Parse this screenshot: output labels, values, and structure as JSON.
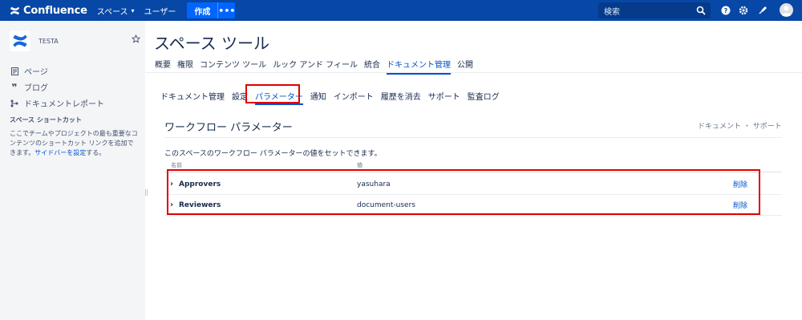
{
  "topbar": {
    "app_name": "Confluence",
    "spaces_label": "スペース",
    "users_label": "ユーザー",
    "create_label": "作成",
    "more_label": "•••",
    "search_placeholder": "検索"
  },
  "sidebar": {
    "space_name": "TESTA",
    "items": [
      {
        "label": "ページ",
        "icon": "page-icon"
      },
      {
        "label": "ブログ",
        "icon": "quote-icon"
      },
      {
        "label": "ドキュメントレポート",
        "icon": "flow-icon"
      }
    ],
    "shortcuts_title": "スペース ショートカット",
    "shortcuts_desc": "ここでチームやプロジェクトの最も重要なコンテンツのショートカット リンクを追加できます。",
    "shortcuts_link": "サイドバーを設定",
    "shortcuts_suffix": "する。"
  },
  "main": {
    "title": "スペース ツール",
    "tabs": [
      {
        "label": "概要"
      },
      {
        "label": "権限"
      },
      {
        "label": "コンテンツ ツール"
      },
      {
        "label": "ルック アンド フィール"
      },
      {
        "label": "統合"
      },
      {
        "label": "ドキュメント管理",
        "active": true
      },
      {
        "label": "公開"
      }
    ],
    "sub_tabs": [
      {
        "label": "ドキュメント管理"
      },
      {
        "label": "設定"
      },
      {
        "label": "パラメーター",
        "active": true
      },
      {
        "label": "通知"
      },
      {
        "label": "インポート"
      },
      {
        "label": "履歴を消去"
      },
      {
        "label": "サポート"
      },
      {
        "label": "監査ログ"
      }
    ],
    "section_title": "ワークフロー パラメーター",
    "breadcrumb_right": "ドキュメント ・ サポート",
    "description": "このスペースのワークフロー パラメーターの値をセットできます。",
    "table": {
      "headers": {
        "name": "名前",
        "value": "値"
      },
      "rows": [
        {
          "name": "Approvers",
          "value": "yasuhara",
          "action": "削除"
        },
        {
          "name": "Reviewers",
          "value": "document-users",
          "action": "削除"
        }
      ]
    }
  },
  "colors": {
    "topbar": "#0747a6",
    "create_button": "#0065ff",
    "link": "#0052cc",
    "highlight": "#e00000",
    "sidebar_bg": "#f4f5f7"
  }
}
